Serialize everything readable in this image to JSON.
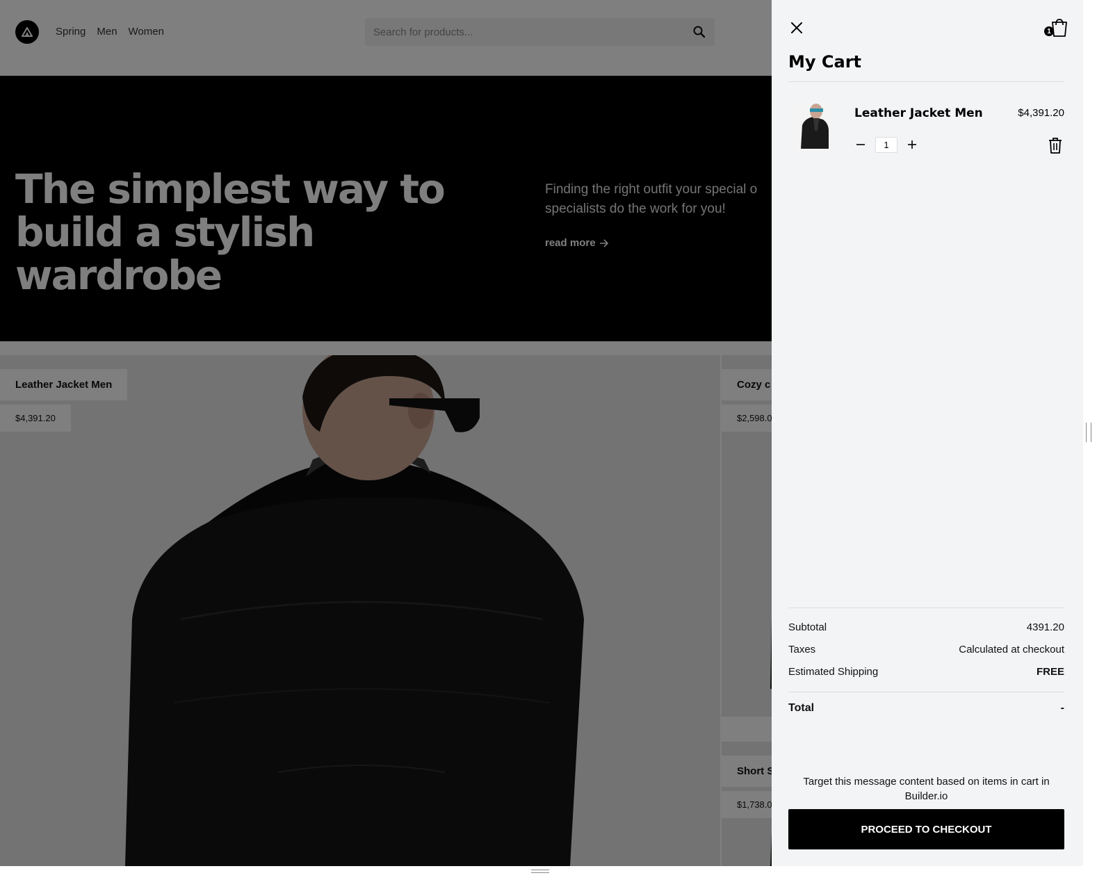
{
  "header": {
    "nav": [
      "Spring",
      "Men",
      "Women"
    ],
    "search_placeholder": "Search for products..."
  },
  "hero": {
    "title_line1": "The simplest way to",
    "title_line2": "build a stylish wardrobe",
    "subtitle_line1": "Finding the right outfit your special o",
    "subtitle_line2": "specialists do the work for you!",
    "read_more": "read more"
  },
  "products": [
    {
      "name": "Leather Jacket Men",
      "price": "$4,391.20"
    },
    {
      "name": "Cozy c",
      "price": "$2,598.0"
    },
    {
      "name": "Short S",
      "price": "$1,738.0"
    }
  ],
  "cart": {
    "title": "My Cart",
    "badge_count": "1",
    "item": {
      "name": "Leather Jacket Men",
      "price": "$4,391.20",
      "quantity": "1"
    },
    "summary": {
      "subtotal_label": "Subtotal",
      "subtotal_value": "4391.20",
      "taxes_label": "Taxes",
      "taxes_value": "Calculated at checkout",
      "shipping_label": "Estimated Shipping",
      "shipping_value": "FREE",
      "total_label": "Total",
      "total_value": "-"
    },
    "message": "Target this message content based on items in cart in Builder.io",
    "checkout_label": "PROCEED TO CHECKOUT"
  },
  "colors": {
    "panel_bg": "#f3f4f6",
    "overlay": "rgba(0,0,0,0.5)",
    "hero_bg": "#000000",
    "button_bg": "#000000"
  }
}
